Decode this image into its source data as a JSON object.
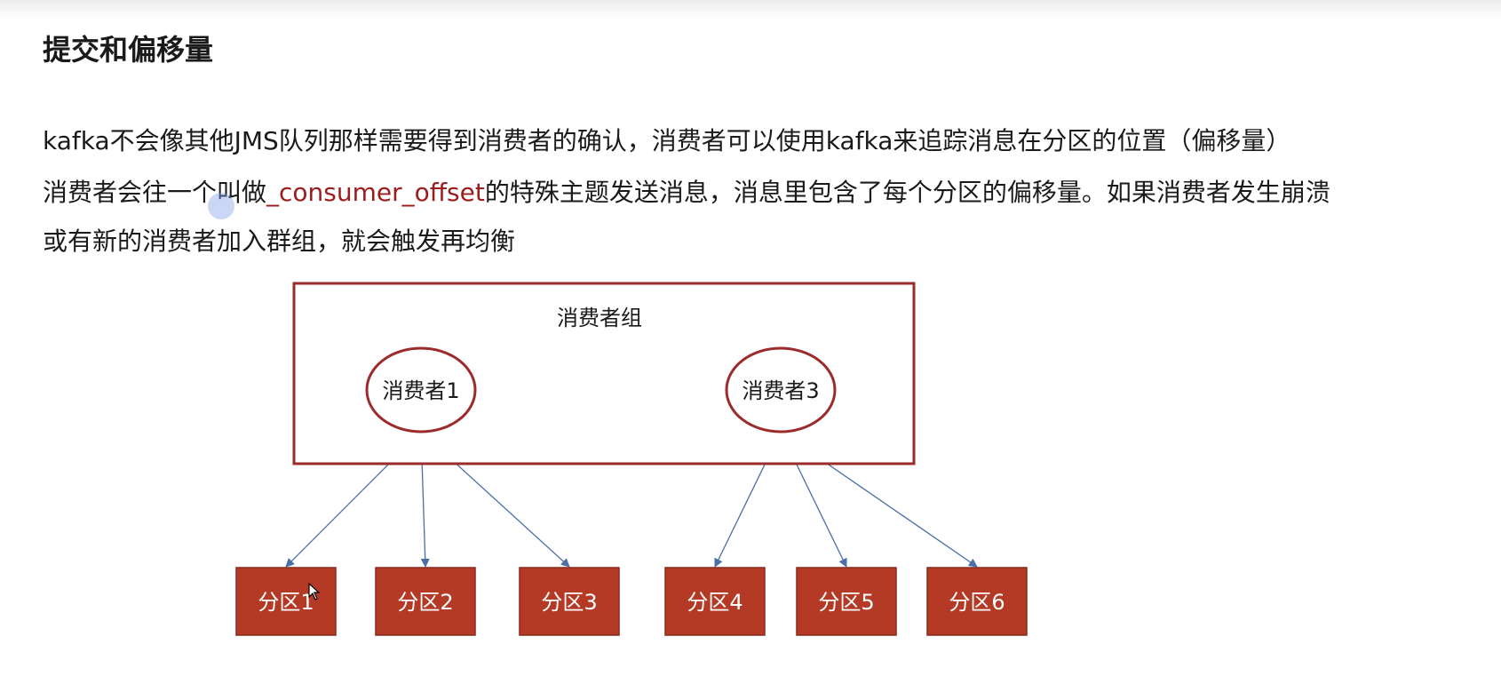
{
  "title": "提交和偏移量",
  "paragraph1": "kafka不会像其他JMS队列那样需要得到消费者的确认，消费者可以使用kafka来追踪消息在分区的位置（偏移量）",
  "paragraph2": {
    "before": "消费者会往一个叫做",
    "highlight": "_consumer_offset",
    "after": "的特殊主题发送消息，消息里包含了每个分区的偏移量。如果消费者发生崩溃"
  },
  "paragraph3": "或有新的消费者加入群组，就会触发再均衡",
  "diagram": {
    "group_label": "消费者组",
    "consumers": [
      {
        "label": "消费者1",
        "partitions": [
          0,
          1,
          2
        ]
      },
      {
        "label": "消费者3",
        "partitions": [
          3,
          4,
          5
        ]
      }
    ],
    "partitions": [
      "分区1",
      "分区2",
      "分区3",
      "分区4",
      "分区5",
      "分区6"
    ],
    "colors": {
      "group_border": "#9c2b2b",
      "consumer_border": "#9c2b2b",
      "partition_fill": "#b53a25",
      "partition_border": "#8a2a1c",
      "arrow": "#4a6fa5",
      "highlight_text": "#9c1c1c"
    }
  }
}
